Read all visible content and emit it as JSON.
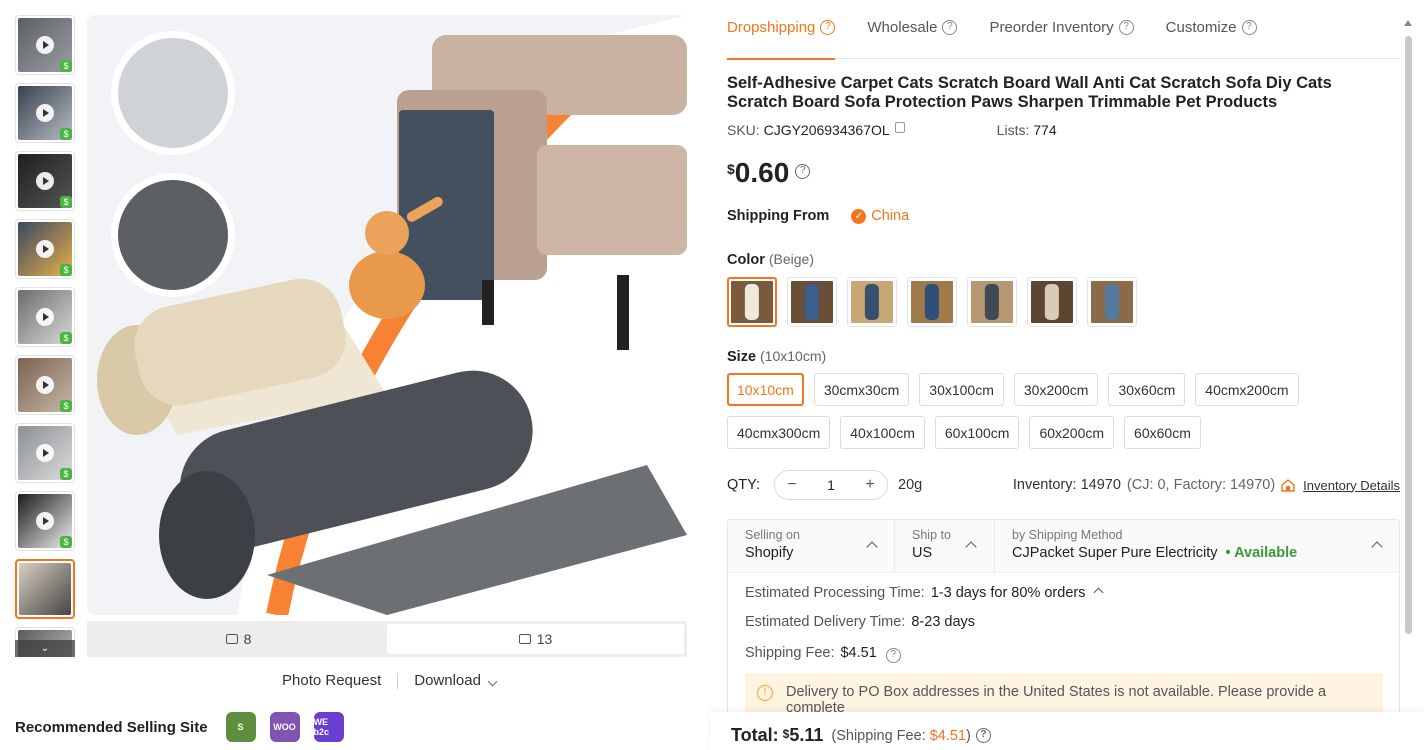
{
  "gallery": {
    "thumbnails": [
      {
        "kind": "video",
        "colors": [
          "#5c5f66",
          "#9a9da2"
        ]
      },
      {
        "kind": "video",
        "colors": [
          "#37424f",
          "#b8bcc3"
        ]
      },
      {
        "kind": "video",
        "colors": [
          "#1f1f1f",
          "#555555"
        ]
      },
      {
        "kind": "video",
        "colors": [
          "#3a4760",
          "#e8b04a"
        ]
      },
      {
        "kind": "video",
        "colors": [
          "#6d6d6d",
          "#d8d8d8"
        ]
      },
      {
        "kind": "video",
        "colors": [
          "#7a6250",
          "#c7b8a8"
        ]
      },
      {
        "kind": "video",
        "colors": [
          "#8b8f94",
          "#dcdcdc"
        ]
      },
      {
        "kind": "video",
        "colors": [
          "#1a1a1a",
          "#f0f0f0"
        ]
      },
      {
        "kind": "image",
        "colors": [
          "#d8d0c0",
          "#444444"
        ]
      },
      {
        "kind": "image",
        "colors": [
          "#5a5a5a",
          "#d0d0d0"
        ]
      }
    ],
    "video_count": "8",
    "image_count": "13",
    "photo_request": "Photo Request",
    "download": "Download"
  },
  "recommended": {
    "label": "Recommended Selling Site",
    "sites": [
      {
        "name": "shopify-icon",
        "text": "S",
        "color": "#5e8e3e"
      },
      {
        "name": "woocommerce-icon",
        "text": "WOO",
        "color": "#7f54b3"
      },
      {
        "name": "wix-b2c-icon",
        "text": "WE b2c",
        "color": "#6a3fd0"
      }
    ]
  },
  "tabs": [
    {
      "label": "Dropshipping",
      "active": true
    },
    {
      "label": "Wholesale",
      "active": false
    },
    {
      "label": "Preorder Inventory",
      "active": false
    },
    {
      "label": "Customize",
      "active": false
    }
  ],
  "product": {
    "title": "Self-Adhesive Carpet Cats Scratch Board Wall Anti Cat Scratch Sofa Diy Cats Scratch Board Sofa Protection Paws Sharpen Trimmable Pet Products",
    "sku_label": "SKU:",
    "sku": "CJGY206934367OL",
    "lists_label": "Lists:",
    "lists": "774",
    "currency": "$",
    "price": "0.60",
    "shipping_from_label": "Shipping From",
    "shipping_from": "China"
  },
  "color": {
    "label": "Color",
    "selected": "(Beige)",
    "swatches": [
      {
        "bg": "#7a5a3a",
        "roll": "#efe8dc",
        "selected": true
      },
      {
        "bg": "#6a4e36",
        "roll": "#3b5f8c",
        "selected": false
      },
      {
        "bg": "#c9a676",
        "roll": "#36506e",
        "selected": false
      },
      {
        "bg": "#a07a4a",
        "roll": "#2f4f78",
        "selected": false
      },
      {
        "bg": "#b89870",
        "roll": "#3f4a55",
        "selected": false
      },
      {
        "bg": "#5c4632",
        "roll": "#d9cbb5",
        "selected": false
      },
      {
        "bg": "#8a6a48",
        "roll": "#557aa0",
        "selected": false
      }
    ]
  },
  "size": {
    "label": "Size",
    "selected": "(10x10cm)",
    "options": [
      {
        "label": "10x10cm",
        "selected": true
      },
      {
        "label": "30cmx30cm",
        "selected": false
      },
      {
        "label": "30x100cm",
        "selected": false
      },
      {
        "label": "30x200cm",
        "selected": false
      },
      {
        "label": "30x60cm",
        "selected": false
      },
      {
        "label": "40cmx200cm",
        "selected": false
      },
      {
        "label": "40cmx300cm",
        "selected": false
      },
      {
        "label": "40x100cm",
        "selected": false
      },
      {
        "label": "60x100cm",
        "selected": false
      },
      {
        "label": "60x200cm",
        "selected": false
      },
      {
        "label": "60x60cm",
        "selected": false
      }
    ]
  },
  "qty": {
    "label": "QTY:",
    "value": "1",
    "weight": "20g",
    "inventory_label": "Inventory:",
    "inventory": "14970",
    "inventory_detail": "(CJ: 0, Factory: 14970)",
    "inventory_link": "Inventory Details"
  },
  "shipping": {
    "selling_on_label": "Selling on",
    "selling_on": "Shopify",
    "ship_to_label": "Ship to",
    "ship_to": "US",
    "method_label": "by Shipping Method",
    "method": "CJPacket Super Pure Electricity",
    "availability": "• Available",
    "processing_label": "Estimated Processing Time:",
    "processing": "1-3 days for 80% orders",
    "delivery_label": "Estimated Delivery Time:",
    "delivery": "8-23 days",
    "fee_label": "Shipping Fee:",
    "fee": "$4.51",
    "warning": "Delivery to PO Box addresses in the United States is not available. Please provide a complete"
  },
  "total": {
    "label": "Total:",
    "currency": "$",
    "amount": "5.11",
    "fee_prefix": "(Shipping Fee:",
    "fee": "$4.51",
    "fee_suffix": ")"
  },
  "colors": {
    "accent": "#f7741e",
    "available": "#3a9a3a"
  }
}
